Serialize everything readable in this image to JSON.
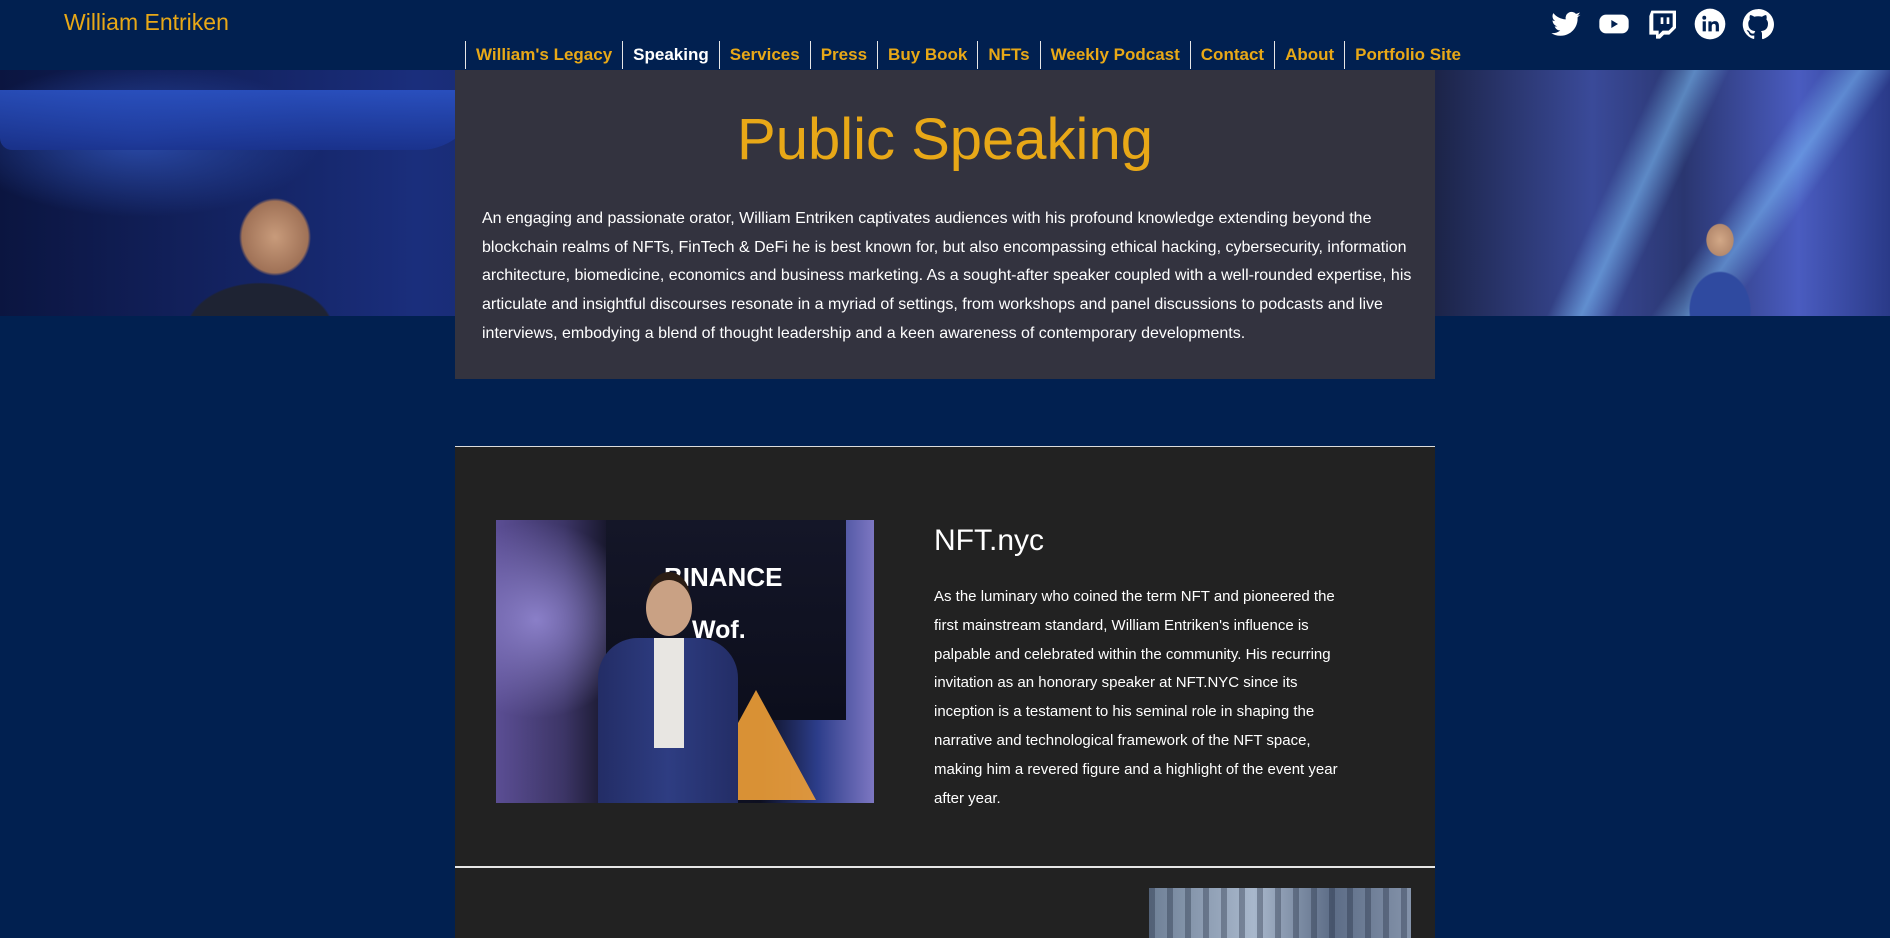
{
  "site": {
    "title": "William Entriken"
  },
  "nav": {
    "items": [
      {
        "label": "William's Legacy",
        "active": false
      },
      {
        "label": "Speaking",
        "active": true
      },
      {
        "label": "Services",
        "active": false
      },
      {
        "label": "Press",
        "active": false
      },
      {
        "label": "Buy Book",
        "active": false
      },
      {
        "label": "NFTs",
        "active": false
      },
      {
        "label": "Weekly Podcast",
        "active": false
      },
      {
        "label": "Contact",
        "active": false
      },
      {
        "label": "About",
        "active": false
      },
      {
        "label": "Portfolio Site",
        "active": false
      }
    ]
  },
  "social": {
    "icons": [
      "twitter-icon",
      "youtube-icon",
      "twitch-icon",
      "linkedin-icon",
      "github-icon"
    ]
  },
  "colors": {
    "background": "#012050",
    "accent": "#e8a817",
    "panel": "#33333f",
    "section": "#222222"
  },
  "intro": {
    "heading": "Public Speaking",
    "body": "An engaging and passionate orator, William Entriken captivates audiences with his profound knowledge extending beyond the blockchain realms of NFTs, FinTech & DeFi he is best known for, but also encompassing ethical hacking, cybersecurity, information architecture, biomedicine, economics and business marketing. As a sought-after speaker coupled with a well-rounded expertise, his articulate and insightful discourses resonate in a myriad of settings, from workshops and panel discussions to podcasts and live interviews, embodying a blend of thought leadership and a keen awareness of contemporary developments."
  },
  "event": {
    "title": "NFT.nyc",
    "body": "As the luminary who coined the term NFT and pioneered the first mainstream standard, William Entriken's influence is palpable and celebrated within the community. His recurring invitation as an honorary speaker at NFT.NYC since its inception is a testament to his seminal role in shaping the narrative and technological framework of the NFT space, making him a revered figure and a highlight of the event year after year.",
    "photo_text": [
      "BINANCE",
      "Wof."
    ]
  }
}
